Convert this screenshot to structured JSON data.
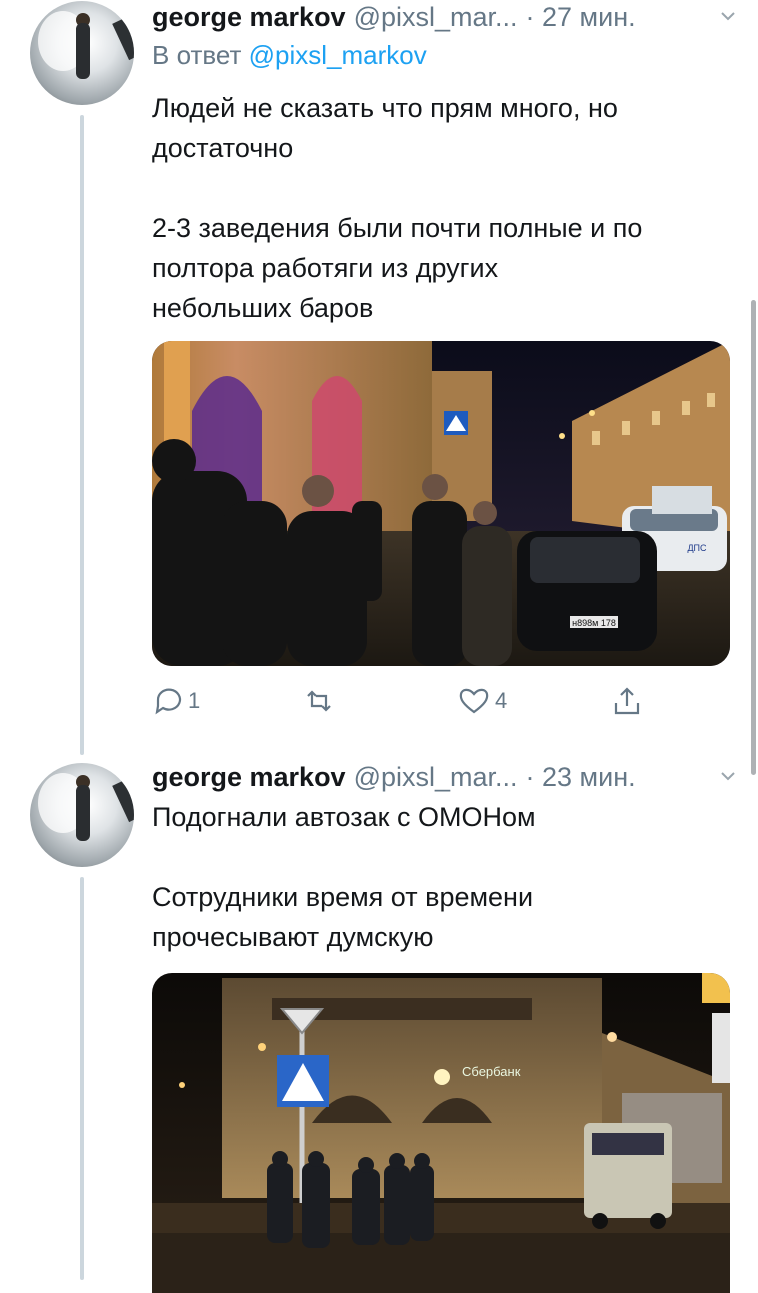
{
  "tweets": [
    {
      "name": "george markov",
      "handle": "@pixsl_mar...",
      "time": "· 27 мин.",
      "reply_prefix": "В ответ",
      "reply_handle": "@pixsl_markov",
      "text": "Людей не сказать что прям много, но\nдостаточно\n\n2-3 заведения были почти полные и по\nполтора работяги из других\nнебольших баров",
      "media": {
        "plate_text": "н898м 178",
        "sign_text": "ДПС"
      },
      "actions": {
        "replies": "1",
        "retweets": "",
        "likes": "4"
      }
    },
    {
      "name": "george markov",
      "handle": "@pixsl_mar...",
      "time": "· 23 мин.",
      "text": "Подогнали автозак с ОМОНом\n\nСотрудники время от времени\nпрочесывают думскую",
      "media": {
        "sign_text": "Сбербанк"
      }
    }
  ],
  "icons": [
    "reply-icon",
    "retweet-icon",
    "like-icon",
    "share-icon",
    "chevron-down-icon"
  ],
  "colors": {
    "link": "#1da1f2",
    "secondary": "#657786",
    "thread_line": "#ccd6dd"
  }
}
